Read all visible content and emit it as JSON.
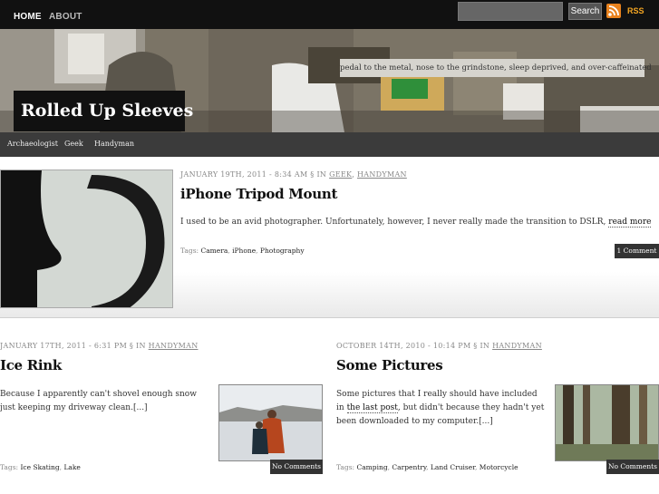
{
  "topbar": {
    "nav": [
      {
        "label": "HOME"
      },
      {
        "label": "ABOUT"
      }
    ],
    "search": {
      "placeholder": "",
      "button_label": "Search"
    },
    "rss_label": "RSS"
  },
  "header": {
    "tagline": "pedal to the metal, nose to the grindstone, sleep deprived, and over-caffeinated",
    "site_title": "Rolled Up Sleeves"
  },
  "categories": [
    {
      "label": "Archaeologist"
    },
    {
      "label": "Geek"
    },
    {
      "label": "Handyman"
    }
  ],
  "posts": [
    {
      "date": "JANUARY 19TH, 2011 - 8:34 AM § IN",
      "cats": [
        "GEEK",
        "HANDYMAN"
      ],
      "title": "iPhone Tripod Mount",
      "excerpt": "I used to be an avid photographer. Unfortunately, however, I never really made the transition to DSLR,",
      "read_more": "read more",
      "tags_label": "Tags:",
      "tags": [
        "Camera",
        "iPhone",
        "Photography"
      ],
      "comments": "1 Comment"
    },
    {
      "date": "JANUARY 17TH, 2011 - 6:31 PM § IN",
      "cats": [
        "HANDYMAN"
      ],
      "title": "Ice Rink",
      "excerpt": "Because I apparently can't shovel enough snow just keeping my driveway clean.[...]",
      "tags_label": "Tags:",
      "tags": [
        "Ice Skating",
        "Lake"
      ],
      "comments": "No Comments"
    },
    {
      "date": "OCTOBER 14TH, 2010 - 10:14 PM § IN",
      "cats": [
        "HANDYMAN"
      ],
      "title": "Some Pictures",
      "excerpt_pre": "Some pictures that I really should have included in",
      "excerpt_link": "the last post",
      "excerpt_post": ", but didn't because they hadn't yet been downloaded to my computer.[...]",
      "tags_label": "Tags:",
      "tags": [
        "Camping",
        "Carpentry",
        "Land Cruiser",
        "Motorcycle"
      ],
      "comments": "No Comments"
    }
  ],
  "colors": {
    "topbar": "#111111",
    "catnav": "#3b3b3b",
    "rss": "#f5a623",
    "title_box": "#111111"
  }
}
